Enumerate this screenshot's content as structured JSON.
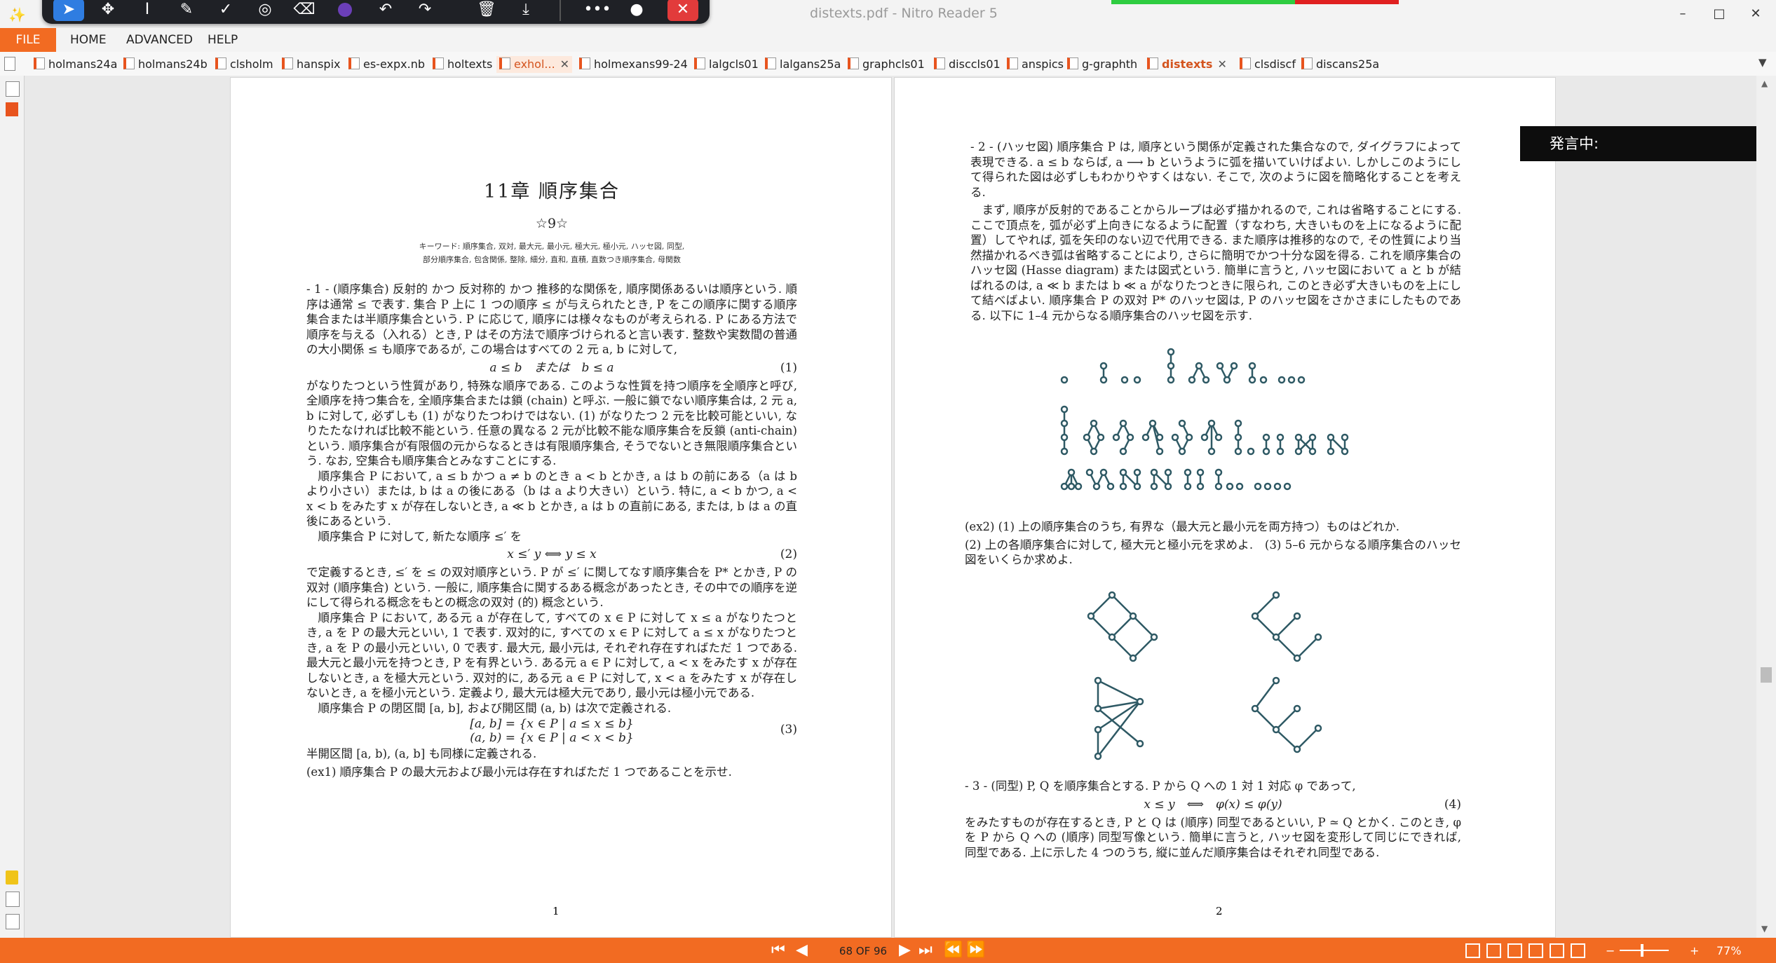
{
  "window": {
    "title": "distexts.pdf - Nitro Reader 5",
    "min": "–",
    "max": "□",
    "close": "✕"
  },
  "floating_toolbar": {
    "tools": [
      "select-arrow",
      "move",
      "text-cursor",
      "pen",
      "check",
      "stamp",
      "eraser",
      "color",
      "undo",
      "redo",
      "delete",
      "download",
      "more",
      "profile",
      "close"
    ]
  },
  "ribbon": {
    "file": "FILE",
    "tabs": [
      "HOME",
      "ADVANCED",
      "HELP"
    ]
  },
  "doc_tabs": [
    {
      "label": "holmans24a"
    },
    {
      "label": "holmans24b"
    },
    {
      "label": "clsholm"
    },
    {
      "label": "hanspix"
    },
    {
      "label": "es-expx.nb"
    },
    {
      "label": "holtexts"
    },
    {
      "label": "exhol...",
      "close": "✕"
    },
    {
      "label": "holmexans99-24"
    },
    {
      "label": "lalgcls01"
    },
    {
      "label": "lalgans25a"
    },
    {
      "label": "graphcls01"
    },
    {
      "label": "disccls01"
    },
    {
      "label": "anspics"
    },
    {
      "label": "g-graphth"
    },
    {
      "label": "distexts",
      "close": "✕"
    },
    {
      "label": "clsdiscf"
    },
    {
      "label": "discans25a"
    }
  ],
  "page1": {
    "title": "11章 順序集合",
    "stars": "☆9☆",
    "keywords_1": "キーワード: 順序集合, 双対, 最大元, 最小元, 極大元, 極小元, ハッセ図, 同型,",
    "keywords_2": "部分順序集合, 包含関係, 整除, 細分, 直和, 直積, 直数つき順序集合, 母関数",
    "p1": "- 1 - (順序集合) 反射的 かつ 反対称的 かつ 推移的な関係を, 順序関係あるいは順序という. 順序は通常 ≤ で表す. 集合 P 上に 1 つの順序 ≤ が与えられたとき, P をこの順序に関する順序集合または半順序集合という. P に応じて, 順序には様々なものが考えられる. P にある方法で順序を与える（入れる）とき, P はその方法で順序づけられると言い表す. 整数や実数間の普通の大小関係 ≤ も順序であるが, この場合はすべての 2 元 a, b に対して,",
    "eq1": "a ≤ b　または　b ≤ a",
    "eq1_num": "(1)",
    "p2": "がなりたつという性質があり, 特殊な順序である. このような性質を持つ順序を全順序と呼び, 全順序を持つ集合を, 全順序集合または鎖 (chain) と呼ぶ. 一般に鎖でない順序集合は, 2 元 a, b に対して, 必ずしも (1) がなりたつわけではない. (1) がなりたつ 2 元を比較可能といい, なりたたなければ比較不能という. 任意の異なる 2 元が比較不能な順序集合を反鎖 (anti-chain) という. 順序集合が有限個の元からなるときは有限順序集合, そうでないとき無限順序集合という. なお, 空集合も順序集合とみなすことにする.",
    "p3": "順序集合 P において, a ≤ b かつ a ≠ b のとき a < b とかき, a は b の前にある（a は b より小さい）または, b は a の後にある（b は a より大きい）という. 特に, a < b かつ, a < x < b をみたす x が存在しないとき, a ≪ b とかき, a は b の直前にある, または, b は a の直後にあるという.",
    "p4": "順序集合 P に対して, 新たな順序 ≤′ を",
    "eq2": "x ≤′ y ⟺ y ≤ x",
    "eq2_num": "(2)",
    "p5": "で定義するとき, ≤′ を ≤ の双対順序という. P が ≤′ に関してなす順序集合を P* とかき, P の双対 (順序集合) という. 一般に, 順序集合に関するある概念があったとき, その中での順序を逆にして得られる概念をもとの概念の双対 (的) 概念という.",
    "p6": "順序集合 P において, ある元 a が存在して, すべての x ∈ P に対して x ≤ a がなりたつとき, a を P の最大元といい, 1 で表す. 双対的に, すべての x ∈ P に対して a ≤ x がなりたつとき, a を P の最小元といい, 0 で表す. 最大元, 最小元は, それぞれ存在すればただ 1 つである. 最大元と最小元を持つとき, P を有界という. ある元 a ∈ P に対して, a < x をみたす x が存在しないとき, a を極大元という. 双対的に, ある元 a ∈ P に対して, x < a をみたす x が存在しないとき, a を極小元という. 定義より, 最大元は極大元であり, 最小元は極小元である.",
    "p7": "順序集合 P の閉区間 [a, b], および開区間 (a, b) は次で定義される.",
    "eq3a": "[a, b] = {x ∈ P | a ≤ x ≤ b}",
    "eq3b": "(a, b) = {x ∈ P | a < x < b}",
    "eq3_num": "(3)",
    "p8": "半開区間 [a, b), (a, b] も同様に定義される.",
    "ex1": "(ex1) 順序集合 P の最大元および最小元は存在すればただ 1 つであることを示せ.",
    "page_number": "1"
  },
  "page2": {
    "p1": "- 2 - (ハッセ図) 順序集合 P は, 順序という関係が定義された集合なので, ダイグラフによって表現できる. a ≤ b ならば, a ⟶ b というように弧を描いていけばよい. しかしこのようにして得られた図は必ずしもわかりやすくはない. そこで, 次のように図を簡略化することを考える.",
    "p2": "まず, 順序が反射的であることからループは必ず描かれるので, これは省略することにする. ここで頂点を, 弧が必ず上向きになるように配置（すなわち, 大きいものを上になるように配置）してやれば, 弧を矢印のない辺で代用できる. また順序は推移的なので, その性質により当然描かれるべき弧は省略することにより, さらに簡明でかつ十分な図を得る. これを順序集合のハッセ図 (Hasse diagram) または図式という. 簡単に言うと, ハッセ図において a と b が結ばれるのは, a ≪ b または b ≪ a がなりたつときに限られ, このとき必ず大きいものを上にして結べばよい. 順序集合 P の双対 P* のハッセ図は, P のハッセ図をさかさまにしたものである. 以下に 1–4 元からなる順序集合のハッセ図を示す.",
    "ex2a": "(ex2) (1) 上の順序集合のうち, 有界な（最大元と最小元を両方持つ）ものはどれか.",
    "ex2b": "(2) 上の各順序集合に対して, 極大元と極小元を求めよ.　(3) 5–6 元からなる順序集合のハッセ図をいくらか求めよ.",
    "p3": "- 3 - (同型) P, Q を順序集合とする. P から Q への 1 対 1 対応 φ であって,",
    "eq4": "x ≤ y　⟺　φ(x) ≤ φ(y)",
    "eq4_num": "(4)",
    "p4": "をみたすものが存在するとき, P と Q は (順序) 同型であるといい, P ≃ Q とかく. このとき, φ を P から Q への (順序) 同型写像という. 簡単に言うと, ハッセ図を変形して同じにできれば, 同型である. 上に示した 4 つのうち, 縦に並んだ順序集合はそれぞれ同型である.",
    "page_number": "2"
  },
  "speech": "発言中:",
  "status": {
    "page_counter": "68 OF 96",
    "zoom": "77%",
    "minus": "−",
    "plus": "+"
  },
  "colors": {
    "accent": "#f26b22",
    "active_tab": "#d4541e",
    "node": "#2e5964"
  }
}
